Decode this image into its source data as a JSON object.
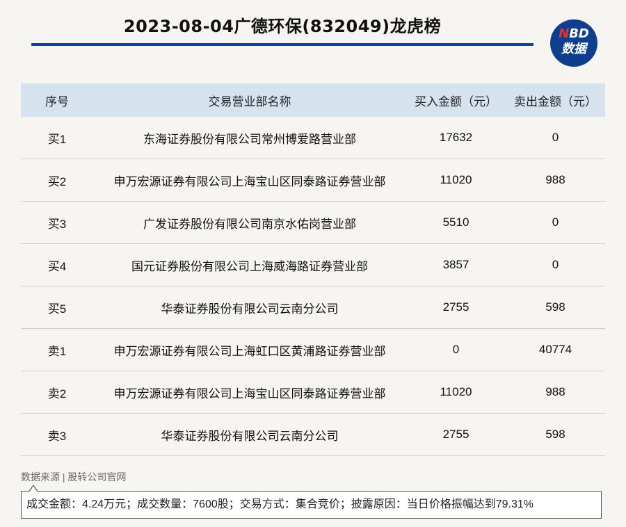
{
  "header": {
    "title": "2023-08-04广德环保(832049)龙虎榜",
    "logo": {
      "line1_accent": "N",
      "line1_rest": "BD",
      "line2": "数据"
    }
  },
  "colors": {
    "background": "#f7f5f1",
    "accent_rule": "#0e4496",
    "table_header_bg": "#d6e3ef",
    "logo_bg": "#0e3f8f",
    "logo_accent": "#e2342d"
  },
  "table": {
    "headers": [
      "序号",
      "交易营业部名称",
      "买入金额（元）",
      "卖出金额（元）"
    ],
    "rows": [
      [
        "买1",
        "东海证券股份有限公司常州博爱路营业部",
        "17632",
        "0"
      ],
      [
        "买2",
        "申万宏源证券有限公司上海宝山区同泰路证券营业部",
        "11020",
        "988"
      ],
      [
        "买3",
        "广发证券股份有限公司南京水佑岗营业部",
        "5510",
        "0"
      ],
      [
        "买4",
        "国元证券股份有限公司上海威海路证券营业部",
        "3857",
        "0"
      ],
      [
        "买5",
        "华泰证券股份有限公司云南分公司",
        "2755",
        "598"
      ],
      [
        "卖1",
        "申万宏源证券有限公司上海虹口区黄浦路证券营业部",
        "0",
        "40774"
      ],
      [
        "卖2",
        "申万宏源证券有限公司上海宝山区同泰路证券营业部",
        "11020",
        "988"
      ],
      [
        "卖3",
        "华泰证券股份有限公司云南分公司",
        "2755",
        "598"
      ]
    ]
  },
  "footer": {
    "source": "数据来源 | 股转公司官网",
    "note": "成交金额：4.24万元；成交数量：7600股；交易方式：集合竞价；披露原因：当日价格振幅达到79.31%"
  }
}
